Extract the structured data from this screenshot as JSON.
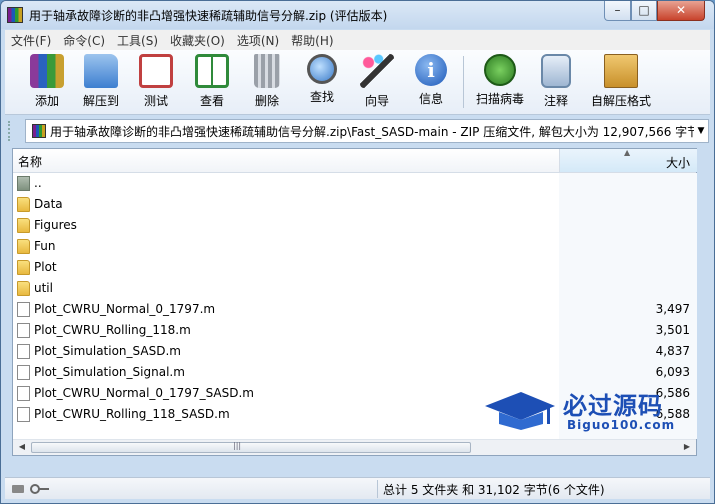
{
  "window": {
    "title": "用于轴承故障诊断的非凸增强快速稀疏辅助信号分解.zip (评估版本)",
    "minimize": "–",
    "maximize": "□",
    "close": "✕"
  },
  "menu": [
    "文件(F)",
    "命令(C)",
    "工具(S)",
    "收藏夹(O)",
    "选项(N)",
    "帮助(H)"
  ],
  "toolbar": [
    {
      "label": "添加",
      "icon": "add-books-icon",
      "color": "#8a3a9a"
    },
    {
      "label": "解压到",
      "icon": "extract-folder-icon",
      "color": "#3d7fd0"
    },
    {
      "label": "测试",
      "icon": "test-clipboard-icon",
      "color": "#c04040"
    },
    {
      "label": "查看",
      "icon": "view-book-icon",
      "color": "#2f8a3a"
    },
    {
      "label": "删除",
      "icon": "trash-icon",
      "color": "#8c9098"
    },
    {
      "label": "查找",
      "icon": "search-magnifier-icon",
      "color": "#3a7ac8"
    },
    {
      "label": "向导",
      "icon": "wizard-wand-icon",
      "color": "#6a8ab8"
    },
    {
      "label": "信息",
      "icon": "info-icon",
      "color": "#2a6cc8"
    },
    {
      "label": "扫描病毒",
      "icon": "virus-scan-icon",
      "color": "#3c9a2c"
    },
    {
      "label": "注释",
      "icon": "comment-icon",
      "color": "#6a88a8"
    },
    {
      "label": "自解压格式",
      "icon": "sfx-box-icon",
      "color": "#c8902a"
    }
  ],
  "address": {
    "path": "用于轴承故障诊断的非凸增强快速稀疏辅助信号分解.zip\\Fast_SASD-main - ZIP 压缩文件, 解包大小为 12,907,566 字节"
  },
  "columns": {
    "name": "名称",
    "size": "大小"
  },
  "files": [
    {
      "name": "..",
      "size": "",
      "type": "up"
    },
    {
      "name": "Data",
      "size": "",
      "type": "folder"
    },
    {
      "name": "Figures",
      "size": "",
      "type": "folder"
    },
    {
      "name": "Fun",
      "size": "",
      "type": "folder"
    },
    {
      "name": "Plot",
      "size": "",
      "type": "folder"
    },
    {
      "name": "util",
      "size": "",
      "type": "folder"
    },
    {
      "name": "Plot_CWRU_Normal_0_1797.m",
      "size": "3,497",
      "type": "file"
    },
    {
      "name": "Plot_CWRU_Rolling_118.m",
      "size": "3,501",
      "type": "file"
    },
    {
      "name": "Plot_Simulation_SASD.m",
      "size": "4,837",
      "type": "file"
    },
    {
      "name": "Plot_Simulation_Signal.m",
      "size": "6,093",
      "type": "file"
    },
    {
      "name": "Plot_CWRU_Normal_0_1797_SASD.m",
      "size": "6,586",
      "type": "file"
    },
    {
      "name": "Plot_CWRU_Rolling_118_SASD.m",
      "size": "6,588",
      "type": "file"
    }
  ],
  "status": {
    "summary": "总计 5 文件夹 和 31,102 字节(6 个文件)"
  },
  "watermark": {
    "cn": "必过源码",
    "en": "Biguo100.com"
  }
}
